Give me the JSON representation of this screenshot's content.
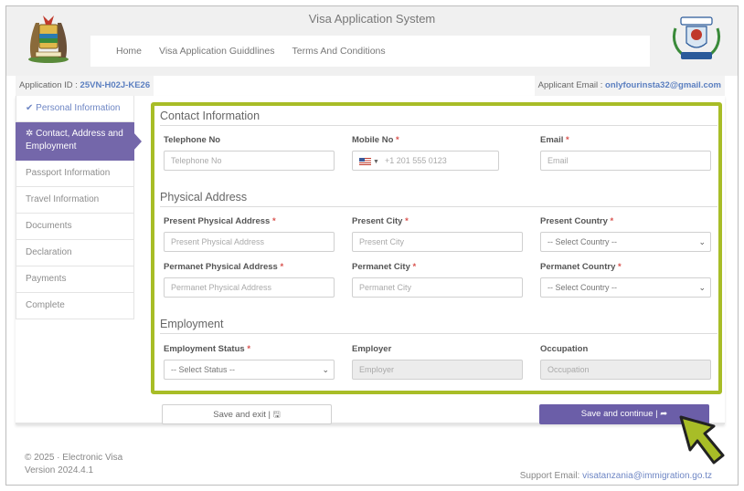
{
  "header": {
    "title": "Visa Application System",
    "nav": [
      "Home",
      "Visa Application Guiddlines",
      "Terms And Conditions"
    ]
  },
  "info": {
    "app_id_label": "Application ID :",
    "app_id": "25VN-H02J-KE26",
    "email_label": "Applicant Email :",
    "email": "onlyfourinsta32@gmail.com"
  },
  "sidebar": {
    "items": [
      {
        "label": "Personal Information",
        "state": "done"
      },
      {
        "label": "Contact, Address and Employment",
        "state": "active"
      },
      {
        "label": "Passport Information",
        "state": "pending"
      },
      {
        "label": "Travel Information",
        "state": "pending"
      },
      {
        "label": "Documents",
        "state": "pending"
      },
      {
        "label": "Declaration",
        "state": "pending"
      },
      {
        "label": "Payments",
        "state": "pending"
      },
      {
        "label": "Complete",
        "state": "pending"
      }
    ]
  },
  "contact": {
    "title": "Contact Information",
    "telephone": {
      "label": "Telephone No",
      "placeholder": "Telephone No"
    },
    "mobile": {
      "label": "Mobile No",
      "placeholder": "+1 201 555 0123"
    },
    "email": {
      "label": "Email",
      "placeholder": "Email"
    }
  },
  "address": {
    "title": "Physical Address",
    "present_address": {
      "label": "Present Physical Address",
      "placeholder": "Present Physical Address"
    },
    "present_city": {
      "label": "Present City",
      "placeholder": "Present City"
    },
    "present_country": {
      "label": "Present Country",
      "value": "-- Select Country --"
    },
    "permanent_address": {
      "label": "Permanet Physical Address",
      "placeholder": "Permanet Physical Address"
    },
    "permanent_city": {
      "label": "Permanet City",
      "placeholder": "Permanet City"
    },
    "permanent_country": {
      "label": "Permanet Country",
      "value": "-- Select Country --"
    }
  },
  "employment": {
    "title": "Employment",
    "status": {
      "label": "Employment Status",
      "value": "-- Select Status --"
    },
    "employer": {
      "label": "Employer",
      "placeholder": "Employer"
    },
    "occupation": {
      "label": "Occupation",
      "placeholder": "Occupation"
    }
  },
  "buttons": {
    "save_exit": "Save and exit |",
    "save_continue": "Save and continue |"
  },
  "footer": {
    "copyright": "© 2025 · Electronic Visa",
    "version": "Version 2024.4.1",
    "support_label": "Support Email:",
    "support_email": "visatanzania@immigration.go.tz"
  },
  "colors": {
    "accent": "#7467aa",
    "highlight": "#a8bd27",
    "link": "#6e86c4",
    "required": "#d9534f"
  }
}
